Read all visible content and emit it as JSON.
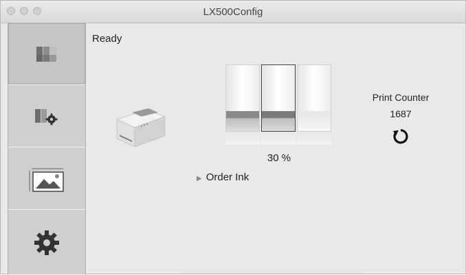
{
  "window": {
    "title": "LX500Config"
  },
  "sidebar": {
    "items": [
      {
        "name": "ink-levels",
        "selected": true
      },
      {
        "name": "printer-settings",
        "selected": false
      },
      {
        "name": "label-setup",
        "selected": false
      },
      {
        "name": "preferences",
        "selected": false
      }
    ]
  },
  "main": {
    "status": "Ready",
    "ink": {
      "level_text": "30 %",
      "level": 0.3,
      "colors": [
        "#8a8a8a",
        "#7a7a7a",
        "#d8d8d8"
      ]
    },
    "order_ink": "Order Ink",
    "print_counter": {
      "label": "Print Counter",
      "value": "1687"
    }
  }
}
